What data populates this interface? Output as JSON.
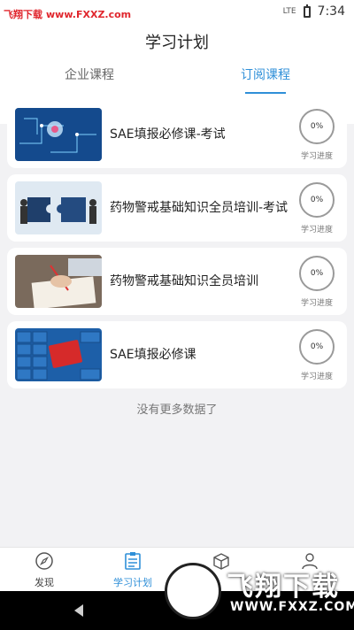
{
  "status_bar": {
    "watermark_site": "飞翔下载",
    "watermark_url": "www.FXXZ.com",
    "time": "7:34",
    "network": "LTE"
  },
  "header": {
    "title": "学习计划",
    "tabs": [
      {
        "label": "企业课程",
        "active": false
      },
      {
        "label": "订阅课程",
        "active": true
      }
    ]
  },
  "courses": [
    {
      "title": "SAE填报必修课-考试",
      "progress": "0%",
      "progress_label": "学习进度"
    },
    {
      "title": "药物警戒基础知识全员培训-考试",
      "progress": "0%",
      "progress_label": "学习进度"
    },
    {
      "title": "药物警戒基础知识全员培训",
      "progress": "0%",
      "progress_label": "学习进度"
    },
    {
      "title": "SAE填报必修课",
      "progress": "0%",
      "progress_label": "学习进度"
    }
  ],
  "footer_message": "没有更多数据了",
  "bottom_nav": [
    {
      "label": "发现",
      "icon": "compass-icon",
      "active": false
    },
    {
      "label": "学习计划",
      "icon": "clipboard-list-icon",
      "active": true
    },
    {
      "label": "",
      "icon": "box-icon",
      "active": false
    },
    {
      "label": "",
      "icon": "person-icon",
      "active": false
    }
  ],
  "watermark_logo": {
    "big_text": "飞翔下载",
    "url_text": "WWW.FXXZ.COM"
  },
  "colors": {
    "accent": "#2f8fd8",
    "background": "#f2f2f4",
    "watermark": "#e0262d"
  }
}
